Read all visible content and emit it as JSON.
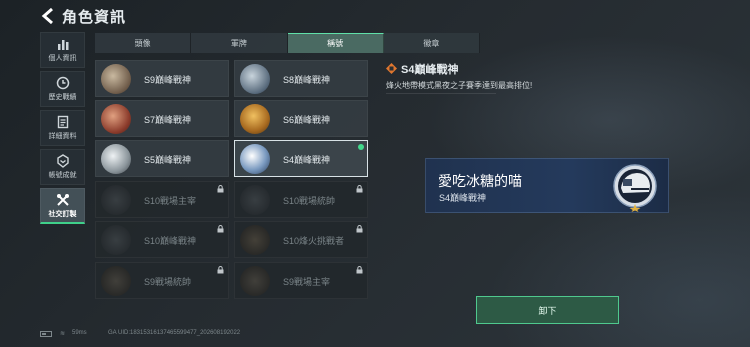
{
  "header": {
    "title": "角色資訊",
    "back_icon": "arrow-left-icon"
  },
  "sidebar": {
    "items": [
      {
        "label": "個人資訊",
        "icon": "bar-chart-icon",
        "active": false
      },
      {
        "label": "歷史戰績",
        "icon": "history-icon",
        "active": false
      },
      {
        "label": "詳細資料",
        "icon": "document-icon",
        "active": false
      },
      {
        "label": "帳號成就",
        "icon": "medal-icon",
        "active": false
      },
      {
        "label": "社交訂製",
        "icon": "wrench-icon",
        "active": true
      }
    ]
  },
  "tabs": [
    {
      "label": "頭像",
      "active": false
    },
    {
      "label": "軍牌",
      "active": false
    },
    {
      "label": "稱號",
      "active": true
    },
    {
      "label": "徽章",
      "active": false
    }
  ],
  "badges": [
    {
      "name": "S9巔峰戰神",
      "locked": false,
      "selected": false,
      "equipped": false
    },
    {
      "name": "S8巔峰戰神",
      "locked": false,
      "selected": false,
      "equipped": false
    },
    {
      "name": "S7巔峰戰神",
      "locked": false,
      "selected": false,
      "equipped": false
    },
    {
      "name": "S6巔峰戰神",
      "locked": false,
      "selected": false,
      "equipped": false
    },
    {
      "name": "S5巔峰戰神",
      "locked": false,
      "selected": false,
      "equipped": false
    },
    {
      "name": "S4巔峰戰神",
      "locked": false,
      "selected": true,
      "equipped": true
    },
    {
      "name": "S10戰場主宰",
      "locked": true,
      "selected": false,
      "equipped": false
    },
    {
      "name": "S10戰場統帥",
      "locked": true,
      "selected": false,
      "equipped": false
    },
    {
      "name": "S10巔峰戰神",
      "locked": true,
      "selected": false,
      "equipped": false
    },
    {
      "name": "S10烽火挑戰者",
      "locked": true,
      "selected": false,
      "equipped": false
    },
    {
      "name": "S9戰場統帥",
      "locked": true,
      "selected": false,
      "equipped": false
    },
    {
      "name": "S9戰場主宰",
      "locked": true,
      "selected": false,
      "equipped": false
    }
  ],
  "detail": {
    "name": "S4巔峰戰神",
    "description": "烽火地帶模式黑夜之子賽季達到最高排位!"
  },
  "preview": {
    "player_name": "愛吃冰糖的喵",
    "title": "S4巔峰戰神"
  },
  "unequip_label": "卸下",
  "footer": {
    "ping": "59ms",
    "uid": "GA UID:1831531613746559947​7_202608192022"
  },
  "colors": {
    "accent": "#42d88c",
    "active_tab": "#4a6a62",
    "button_bg": "#2d5a45",
    "preview_bg": "#243a5c"
  }
}
